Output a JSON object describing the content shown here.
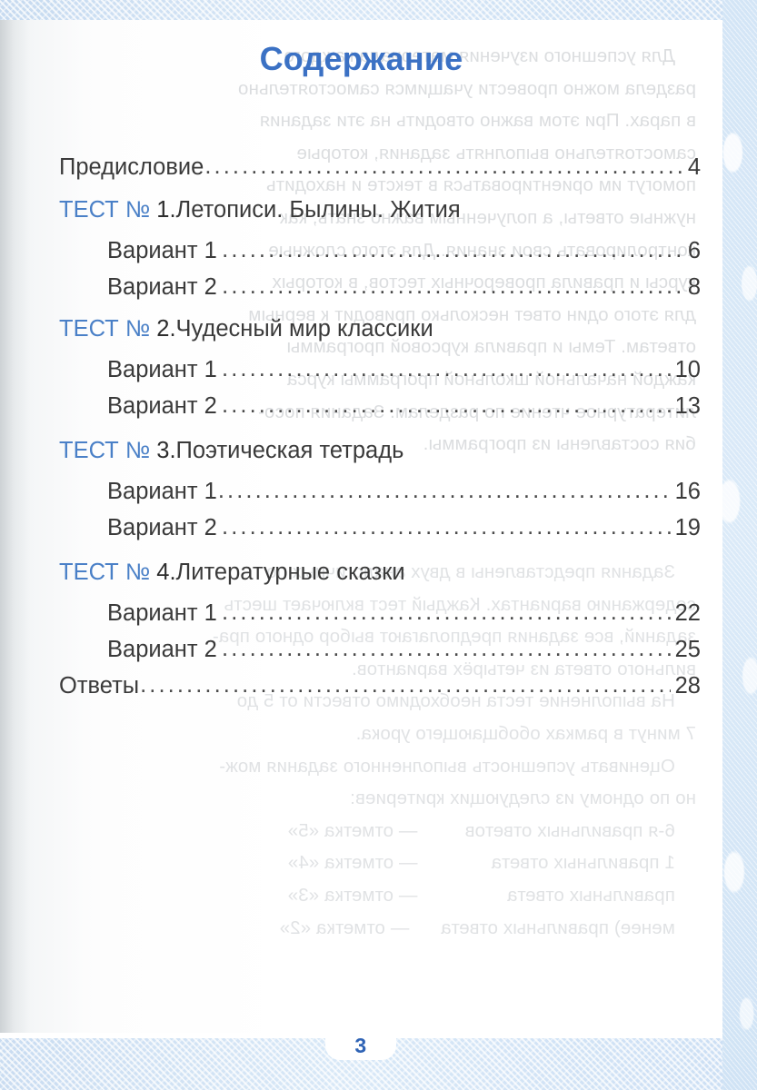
{
  "page": {
    "title": "Содержание",
    "page_number": "3",
    "title_color": "#3b71c4",
    "accent_color": "#4a80c7",
    "text_color": "#3a3a3a",
    "border_color": "#cfe0f2"
  },
  "contents": {
    "entries": [
      {
        "kind": "plain",
        "label": "Предисловие",
        "page": "4",
        "space_before_leader": false
      },
      {
        "kind": "heading",
        "keyword": "ТЕСТ №",
        "number": "1.",
        "label": " Летописи. Былины. Жития"
      },
      {
        "kind": "variant",
        "label": "Вариант 1",
        "page": "6",
        "space_before_leader": true
      },
      {
        "kind": "variant",
        "label": "Вариант 2",
        "page": "8",
        "space_before_leader": true
      },
      {
        "kind": "heading",
        "keyword": "ТЕСТ №",
        "number": "2.",
        "label": " Чудесный мир классики"
      },
      {
        "kind": "variant",
        "label": "Вариант 1",
        "page": "10",
        "space_before_leader": true
      },
      {
        "kind": "variant",
        "label": "Вариант 2",
        "page": "13",
        "space_before_leader": true
      },
      {
        "kind": "heading",
        "keyword": "ТЕСТ №",
        "number": "3.",
        "label": " Поэтическая тетрадь"
      },
      {
        "kind": "variant",
        "label": "Вариант 1",
        "page": "16",
        "space_before_leader": false
      },
      {
        "kind": "variant",
        "label": "Вариант 2",
        "page": "19",
        "space_before_leader": true
      },
      {
        "kind": "heading",
        "keyword": "ТЕСТ №",
        "number": "4.",
        "label": " Литературные сказки"
      },
      {
        "kind": "variant",
        "label": "Вариант 1",
        "page": "22",
        "space_before_leader": true
      },
      {
        "kind": "variant",
        "label": "Вариант 2",
        "page": "25",
        "space_before_leader": true
      },
      {
        "kind": "plain",
        "label": "Ответы",
        "page": "28",
        "space_before_leader": false
      }
    ]
  },
  "bleed_through": {
    "block1": "    Для успешного изучения материала каждого\nраздела можно провести учащимся самостоятельно\nв парах. При этом важно отводить на эти задания\nсамостоятельно выполнять задания, которые\nпомогут им ориентироваться в тексте и находить\nнужные ответы, а полученным важно знать, как\nконтролировать свои знания. Для этого сложные\nкурсы и правила проверочных тестов, в которых\nдля этого один ответ несколько приводит к верным\nответам. Темы и правила курсовой программы\nкаждой начальной школьной программы курса\nлитературное чтение по разделам. Задания посо-\nбия составлены из программы.",
    "block2": "    Задания представлены в двух аналогичных по\nсодержанию вариантах. Каждый тест включает шесть\nзаданий, все задания предполагают выбор одного пра-\nвильного ответа из четырёх вариантов.\n    На выполнение теста необходимо отвести от 5 до\n7 минут в рамках обобщающего урока.\n    Оценивать успешность выполненного задания мож-\nно по одному из следующих критериев:\n    6-я правильных ответов         — отметка «5»\n    1 правильных ответа              — отметка «4»\n    правильных ответа                 — отметка «3»\n    менее) правильных ответа      — отметка «2»"
  }
}
